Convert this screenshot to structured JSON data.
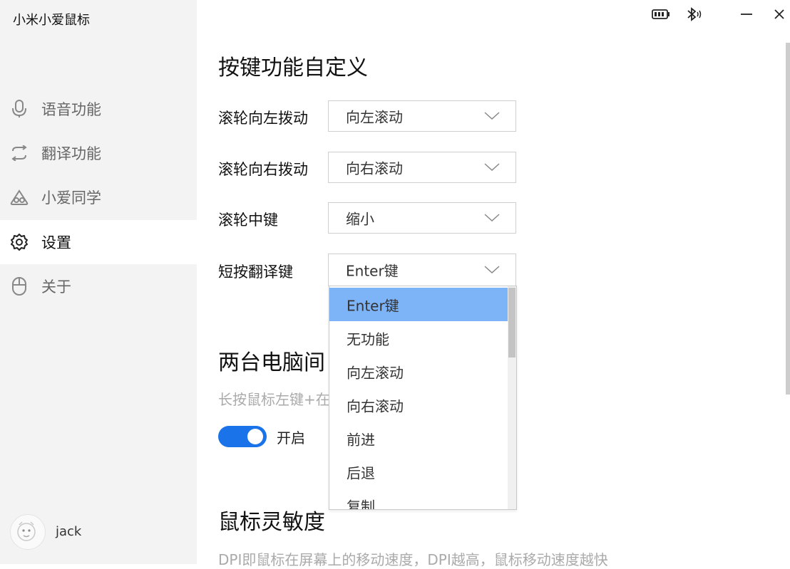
{
  "app": {
    "title": "小米小爱鼠标"
  },
  "sidebar": {
    "items": [
      {
        "label": "语音功能",
        "icon": "microphone-icon"
      },
      {
        "label": "翻译功能",
        "icon": "translate-icon"
      },
      {
        "label": "小爱同学",
        "icon": "xiaoai-icon"
      },
      {
        "label": "设置",
        "icon": "gear-icon",
        "active": true
      },
      {
        "label": "关于",
        "icon": "mouse-icon"
      }
    ],
    "user": {
      "name": "jack"
    }
  },
  "main": {
    "button_section": {
      "title": "按键功能自定义",
      "rows": [
        {
          "label": "滚轮向左拨动",
          "value": "向左滚动"
        },
        {
          "label": "滚轮向右拨动",
          "value": "向右滚动"
        },
        {
          "label": "滚轮中键",
          "value": "缩小"
        },
        {
          "label": "短按翻译键",
          "value": "Enter键"
        }
      ]
    },
    "dual_pc_section": {
      "title": "两台电脑间",
      "desc": "长按鼠标左键+在",
      "toggle": {
        "label": "开启",
        "on": true
      }
    },
    "sensitivity_section": {
      "title": "鼠标灵敏度",
      "desc": "DPI即鼠标在屏幕上的移动速度，DPI越高，鼠标移动速度越快"
    }
  },
  "dropdown": {
    "selected": "Enter键",
    "options": [
      "Enter键",
      "无功能",
      "向左滚动",
      "向右滚动",
      "前进",
      "后退",
      "复制"
    ]
  },
  "colors": {
    "accent": "#1a73e8",
    "selected_option": "#7db3f7",
    "sidebar_bg": "#f3f3f3"
  }
}
